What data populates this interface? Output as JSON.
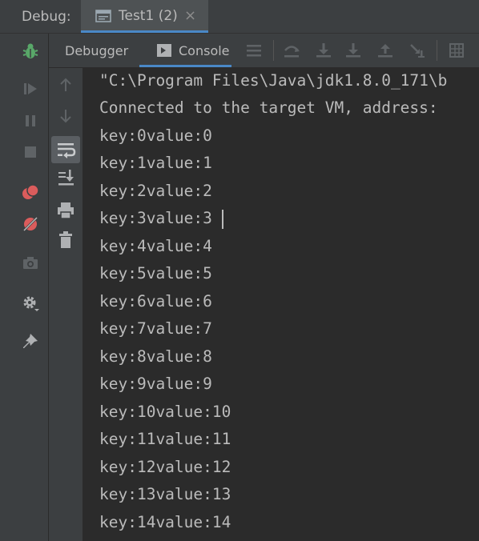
{
  "titlebar": {
    "label": "Debug:",
    "tab_label": "Test1 (2)",
    "tab_icon": "window-icon",
    "close_glyph": "×"
  },
  "tabbar": {
    "debugger_label": "Debugger",
    "console_label": "Console",
    "icons": [
      "menu-icon",
      "step-over-icon",
      "step-into-icon",
      "force-step-into-icon",
      "step-out-icon",
      "run-to-cursor-icon",
      "evaluate-icon"
    ]
  },
  "left_toolbar": {
    "icons": [
      "debug-bug-icon",
      "resume-icon",
      "pause-icon",
      "stop-icon",
      "view-breakpoints-icon",
      "mute-breakpoints-icon",
      "camera-icon",
      "settings-icon",
      "pin-icon"
    ]
  },
  "gutter": {
    "icons": [
      "up-arrow-icon",
      "down-arrow-icon",
      "soft-wrap-icon",
      "scroll-to-end-icon",
      "print-icon",
      "clear-icon"
    ]
  },
  "console": {
    "lines": [
      "\"C:\\Program Files\\Java\\jdk1.8.0_171\\b",
      "Connected to the target VM, address:",
      "key:0value:0",
      "key:1value:1",
      "key:2value:2",
      "key:3value:3",
      "key:4value:4",
      "key:5value:5",
      "key:6value:6",
      "key:7value:7",
      "key:8value:8",
      "key:9value:9",
      "key:10value:10",
      "key:11value:11",
      "key:12value:12",
      "key:13value:13",
      "key:14value:14"
    ]
  },
  "colors": {
    "accent": "#4a88c7",
    "bug_green": "#59a869",
    "breakpoint_red": "#db5c5c"
  }
}
